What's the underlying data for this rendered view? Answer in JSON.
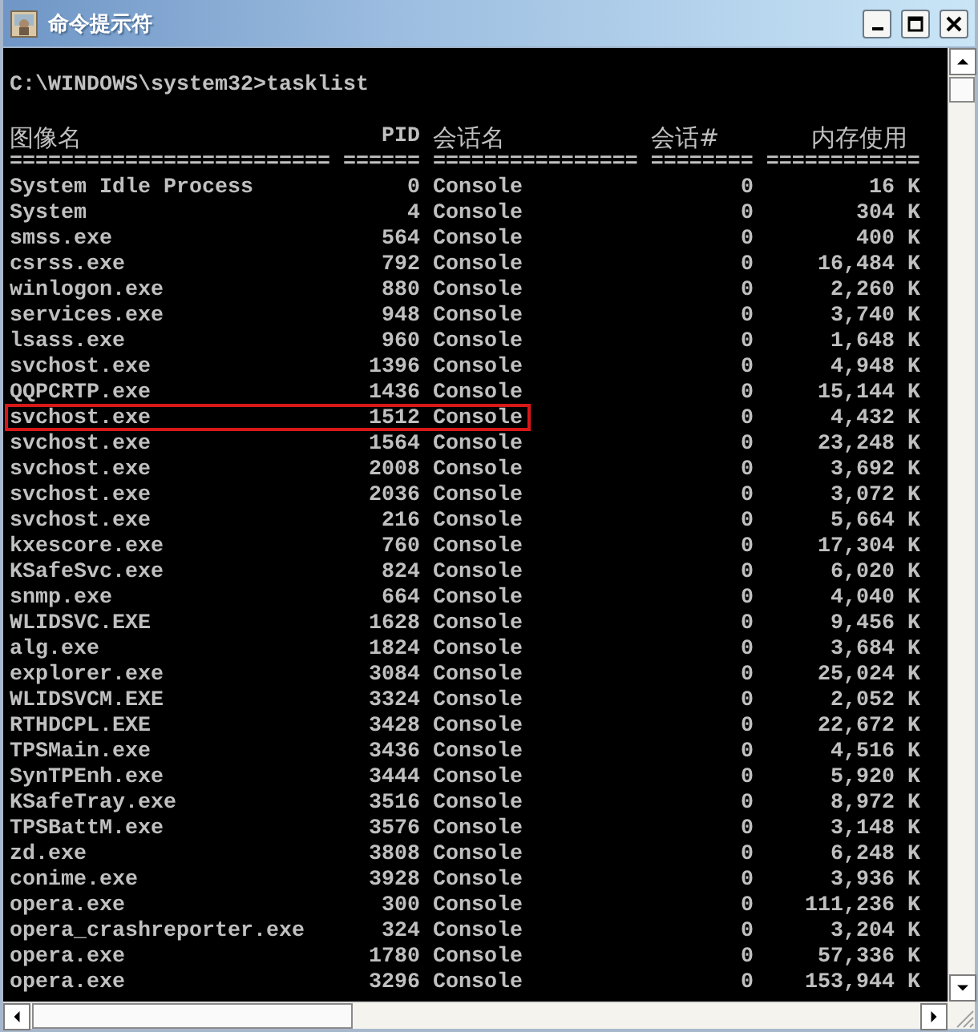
{
  "window": {
    "title": "命令提示符"
  },
  "console": {
    "prompt": "C:\\WINDOWS\\system32>tasklist",
    "columns": [
      "图像名",
      "PID",
      "会话名",
      "会话#",
      "内存使用"
    ],
    "rule": "========================= ====== ================ ======== ============",
    "rows": [
      {
        "image": "System Idle Process",
        "pid": "0",
        "session": "Console",
        "session_num": "0",
        "mem": "16 K",
        "highlighted": false
      },
      {
        "image": "System",
        "pid": "4",
        "session": "Console",
        "session_num": "0",
        "mem": "304 K",
        "highlighted": false
      },
      {
        "image": "smss.exe",
        "pid": "564",
        "session": "Console",
        "session_num": "0",
        "mem": "400 K",
        "highlighted": false
      },
      {
        "image": "csrss.exe",
        "pid": "792",
        "session": "Console",
        "session_num": "0",
        "mem": "16,484 K",
        "highlighted": false
      },
      {
        "image": "winlogon.exe",
        "pid": "880",
        "session": "Console",
        "session_num": "0",
        "mem": "2,260 K",
        "highlighted": false
      },
      {
        "image": "services.exe",
        "pid": "948",
        "session": "Console",
        "session_num": "0",
        "mem": "3,740 K",
        "highlighted": false
      },
      {
        "image": "lsass.exe",
        "pid": "960",
        "session": "Console",
        "session_num": "0",
        "mem": "1,648 K",
        "highlighted": false
      },
      {
        "image": "svchost.exe",
        "pid": "1396",
        "session": "Console",
        "session_num": "0",
        "mem": "4,948 K",
        "highlighted": false
      },
      {
        "image": "QQPCRTP.exe",
        "pid": "1436",
        "session": "Console",
        "session_num": "0",
        "mem": "15,144 K",
        "highlighted": false
      },
      {
        "image": "svchost.exe",
        "pid": "1512",
        "session": "Console",
        "session_num": "0",
        "mem": "4,432 K",
        "highlighted": true
      },
      {
        "image": "svchost.exe",
        "pid": "1564",
        "session": "Console",
        "session_num": "0",
        "mem": "23,248 K",
        "highlighted": false
      },
      {
        "image": "svchost.exe",
        "pid": "2008",
        "session": "Console",
        "session_num": "0",
        "mem": "3,692 K",
        "highlighted": false
      },
      {
        "image": "svchost.exe",
        "pid": "2036",
        "session": "Console",
        "session_num": "0",
        "mem": "3,072 K",
        "highlighted": false
      },
      {
        "image": "svchost.exe",
        "pid": "216",
        "session": "Console",
        "session_num": "0",
        "mem": "5,664 K",
        "highlighted": false
      },
      {
        "image": "kxescore.exe",
        "pid": "760",
        "session": "Console",
        "session_num": "0",
        "mem": "17,304 K",
        "highlighted": false
      },
      {
        "image": "KSafeSvc.exe",
        "pid": "824",
        "session": "Console",
        "session_num": "0",
        "mem": "6,020 K",
        "highlighted": false
      },
      {
        "image": "snmp.exe",
        "pid": "664",
        "session": "Console",
        "session_num": "0",
        "mem": "4,040 K",
        "highlighted": false
      },
      {
        "image": "WLIDSVC.EXE",
        "pid": "1628",
        "session": "Console",
        "session_num": "0",
        "mem": "9,456 K",
        "highlighted": false
      },
      {
        "image": "alg.exe",
        "pid": "1824",
        "session": "Console",
        "session_num": "0",
        "mem": "3,684 K",
        "highlighted": false
      },
      {
        "image": "explorer.exe",
        "pid": "3084",
        "session": "Console",
        "session_num": "0",
        "mem": "25,024 K",
        "highlighted": false
      },
      {
        "image": "WLIDSVCM.EXE",
        "pid": "3324",
        "session": "Console",
        "session_num": "0",
        "mem": "2,052 K",
        "highlighted": false
      },
      {
        "image": "RTHDCPL.EXE",
        "pid": "3428",
        "session": "Console",
        "session_num": "0",
        "mem": "22,672 K",
        "highlighted": false
      },
      {
        "image": "TPSMain.exe",
        "pid": "3436",
        "session": "Console",
        "session_num": "0",
        "mem": "4,516 K",
        "highlighted": false
      },
      {
        "image": "SynTPEnh.exe",
        "pid": "3444",
        "session": "Console",
        "session_num": "0",
        "mem": "5,920 K",
        "highlighted": false
      },
      {
        "image": "KSafeTray.exe",
        "pid": "3516",
        "session": "Console",
        "session_num": "0",
        "mem": "8,972 K",
        "highlighted": false
      },
      {
        "image": "TPSBattM.exe",
        "pid": "3576",
        "session": "Console",
        "session_num": "0",
        "mem": "3,148 K",
        "highlighted": false
      },
      {
        "image": "zd.exe",
        "pid": "3808",
        "session": "Console",
        "session_num": "0",
        "mem": "6,248 K",
        "highlighted": false
      },
      {
        "image": "conime.exe",
        "pid": "3928",
        "session": "Console",
        "session_num": "0",
        "mem": "3,936 K",
        "highlighted": false
      },
      {
        "image": "opera.exe",
        "pid": "300",
        "session": "Console",
        "session_num": "0",
        "mem": "111,236 K",
        "highlighted": false
      },
      {
        "image": "opera_crashreporter.exe",
        "pid": "324",
        "session": "Console",
        "session_num": "0",
        "mem": "3,204 K",
        "highlighted": false
      },
      {
        "image": "opera.exe",
        "pid": "1780",
        "session": "Console",
        "session_num": "0",
        "mem": "57,336 K",
        "highlighted": false
      },
      {
        "image": "opera.exe",
        "pid": "3296",
        "session": "Console",
        "session_num": "0",
        "mem": "153,944 K",
        "highlighted": false
      }
    ]
  }
}
